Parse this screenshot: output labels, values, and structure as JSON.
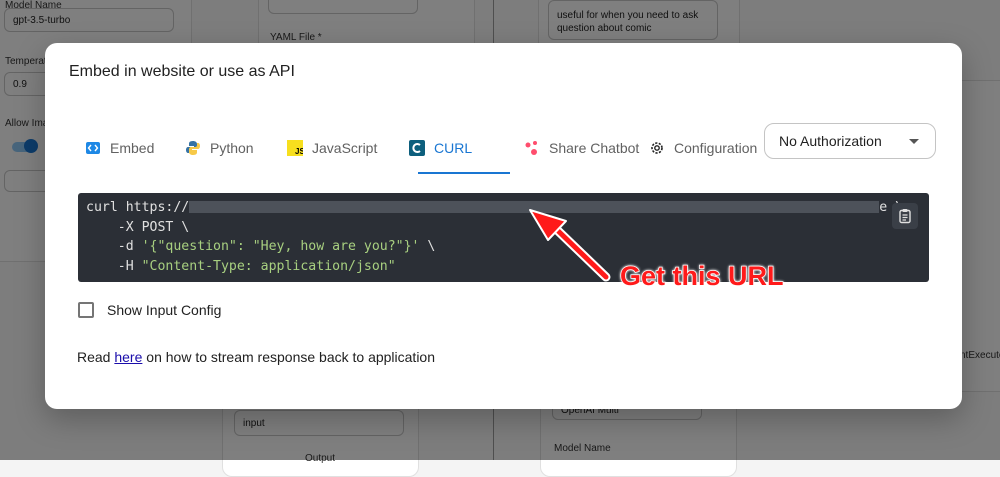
{
  "background": {
    "model_label": "Model Name",
    "model_value": "gpt-3.5-turbo",
    "temperature_label": "Temperature",
    "temperature_value": "0.9",
    "allow_image_label": "Allow Ima",
    "yaml_label": "YAML File *",
    "description_text": "useful for when you need to ask question about comic",
    "input_value": "input",
    "output_label": "Output",
    "openai_select": "OpenAI Multi",
    "model_name_label": "Model Name",
    "agent_executor_label": "ntExecuto",
    "side_letter": "t"
  },
  "dialog": {
    "title": "Embed in website or use as API",
    "tabs": [
      {
        "label": "Embed",
        "icon": "code-embed-icon"
      },
      {
        "label": "Python",
        "icon": "python-icon"
      },
      {
        "label": "JavaScript",
        "icon": "javascript-icon"
      },
      {
        "label": "CURL",
        "icon": "curl-icon",
        "active": true
      },
      {
        "label": "Share Chatbot",
        "icon": "share-icon"
      },
      {
        "label": "Configuration",
        "icon": "gear-icon"
      }
    ],
    "auth_select": "No Authorization",
    "code": {
      "line1_prefix": "curl https://",
      "line1_suffix": "e \\",
      "line2": "    -X POST \\",
      "line3_prefix": "    -d ",
      "line3_string": "'{\"question\": \"Hey, how are you?\"}'",
      "line3_suffix": " \\",
      "line4_prefix": "    -H ",
      "line4_string": "\"Content-Type: application/json\""
    },
    "show_input_config_label": "Show Input Config",
    "read_prefix": "Read ",
    "read_link": "here",
    "read_suffix": " on how to stream response back to application"
  },
  "annotation": {
    "text": "Get this URL",
    "color": "#ff1a1a"
  }
}
